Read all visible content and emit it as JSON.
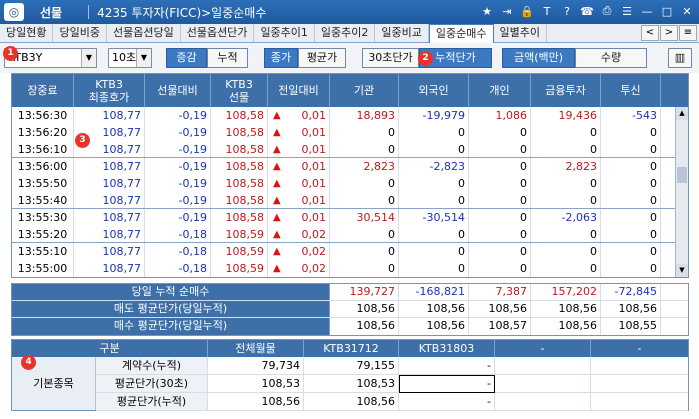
{
  "titlebar": {
    "app_name": "선물",
    "screen_title": "4235 투자자(FICC)>일중순매수",
    "icons": [
      "star-icon",
      "export-icon",
      "lock-icon",
      "text-icon",
      "help-icon",
      "phone-icon",
      "print-icon",
      "list-icon",
      "minimize-icon",
      "maximize-icon",
      "close-icon"
    ]
  },
  "tabs": [
    "당일현황",
    "당일비중",
    "선물옵션당일",
    "선물옵션단가",
    "일중추이1",
    "일중추이2",
    "일중비교",
    "일중순매수",
    "일별추이"
  ],
  "active_tab_index": 7,
  "toolbar": {
    "symbol_value": "KTB3Y",
    "interval_value": "10초",
    "btn_change": "증감",
    "btn_cumulative": "누적",
    "btn_close_price": "종가",
    "btn_avg_price": "평균가",
    "btn_30s": "30초단가",
    "btn_cum_price": "누적단가",
    "btn_amount": "금액(백만)",
    "btn_quantity": "수량",
    "markers": [
      "1",
      "2",
      "3",
      "4"
    ]
  },
  "grid": {
    "headers": {
      "time": "장중료",
      "last_line1": "KTB3",
      "last_line2": "최종호가",
      "diff": "선물대비",
      "fut_line1": "KTB3",
      "fut_line2": "선물",
      "prev": "전일대비",
      "inst": "기관",
      "foreign": "외국인",
      "indiv": "개인",
      "fin": "금융투자",
      "trust": "투신"
    },
    "rows": [
      {
        "time": "13:56:30",
        "last": "108,77",
        "diff": "-0,19",
        "fut": "108,58",
        "prev": "0,01",
        "inst": "18,893",
        "foreign": "-19,979",
        "indiv": "1,086",
        "fin": "19,436",
        "trust": "-543"
      },
      {
        "time": "13:56:20",
        "last": "108,77",
        "diff": "-0,19",
        "fut": "108,58",
        "prev": "0,01",
        "inst": "0",
        "foreign": "0",
        "indiv": "0",
        "fin": "0",
        "trust": "0"
      },
      {
        "time": "13:56:10",
        "last": "108,77",
        "diff": "-0,19",
        "fut": "108,58",
        "prev": "0,01",
        "inst": "0",
        "foreign": "0",
        "indiv": "0",
        "fin": "0",
        "trust": "0"
      },
      {
        "time": "13:56:00",
        "last": "108,77",
        "diff": "-0,19",
        "fut": "108,58",
        "prev": "0,01",
        "inst": "2,823",
        "foreign": "-2,823",
        "indiv": "0",
        "fin": "2,823",
        "trust": "0"
      },
      {
        "time": "13:55:50",
        "last": "108,77",
        "diff": "-0,19",
        "fut": "108,58",
        "prev": "0,01",
        "inst": "0",
        "foreign": "0",
        "indiv": "0",
        "fin": "0",
        "trust": "0"
      },
      {
        "time": "13:55:40",
        "last": "108,77",
        "diff": "-0,19",
        "fut": "108,58",
        "prev": "0,01",
        "inst": "0",
        "foreign": "0",
        "indiv": "0",
        "fin": "0",
        "trust": "0"
      },
      {
        "time": "13:55:30",
        "last": "108,77",
        "diff": "-0,19",
        "fut": "108,58",
        "prev": "0,01",
        "inst": "30,514",
        "foreign": "-30,514",
        "indiv": "0",
        "fin": "-2,063",
        "trust": "0"
      },
      {
        "time": "13:55:20",
        "last": "108,77",
        "diff": "-0,18",
        "fut": "108,59",
        "prev": "0,02",
        "inst": "0",
        "foreign": "0",
        "indiv": "0",
        "fin": "0",
        "trust": "0"
      },
      {
        "time": "13:55:10",
        "last": "108,77",
        "diff": "-0,18",
        "fut": "108,59",
        "prev": "0,02",
        "inst": "0",
        "foreign": "0",
        "indiv": "0",
        "fin": "0",
        "trust": "0"
      },
      {
        "time": "13:55:00",
        "last": "108,77",
        "diff": "-0,18",
        "fut": "108,59",
        "prev": "0,02",
        "inst": "0",
        "foreign": "0",
        "indiv": "0",
        "fin": "0",
        "trust": "0"
      }
    ]
  },
  "summary": {
    "rows": [
      {
        "label": "당일 누적 순매수",
        "values": [
          "139,727",
          "-168,821",
          "7,387",
          "157,202",
          "-72,845"
        ]
      },
      {
        "label": "매도 평균단가(당일누적)",
        "values": [
          "108,56",
          "108,56",
          "108,56",
          "108,56",
          "108,56"
        ]
      },
      {
        "label": "매수 평균단가(당일누적)",
        "values": [
          "108,56",
          "108,56",
          "108,57",
          "108,56",
          "108,55"
        ]
      }
    ]
  },
  "bottom": {
    "headers": [
      "구분",
      "전체월물",
      "KTB31712",
      "KTB31803",
      "-",
      "-"
    ],
    "side_label": "기본종목",
    "rows": [
      {
        "label": "계약수(누적)",
        "values": [
          "79,734",
          "79,155",
          "-",
          "",
          ""
        ]
      },
      {
        "label": "평균단가(30초)",
        "values": [
          "108,53",
          "108,53",
          "-",
          "",
          ""
        ]
      },
      {
        "label": "평균단가(누적)",
        "values": [
          "108,56",
          "108,56",
          "-",
          "",
          ""
        ]
      }
    ]
  },
  "colors": {
    "header_blue": "#3d6fa8",
    "accent_blue": "#3c79c2",
    "positive_red": "#c01818",
    "negative_blue": "#1a33b8",
    "marker_red": "#e8322a"
  }
}
